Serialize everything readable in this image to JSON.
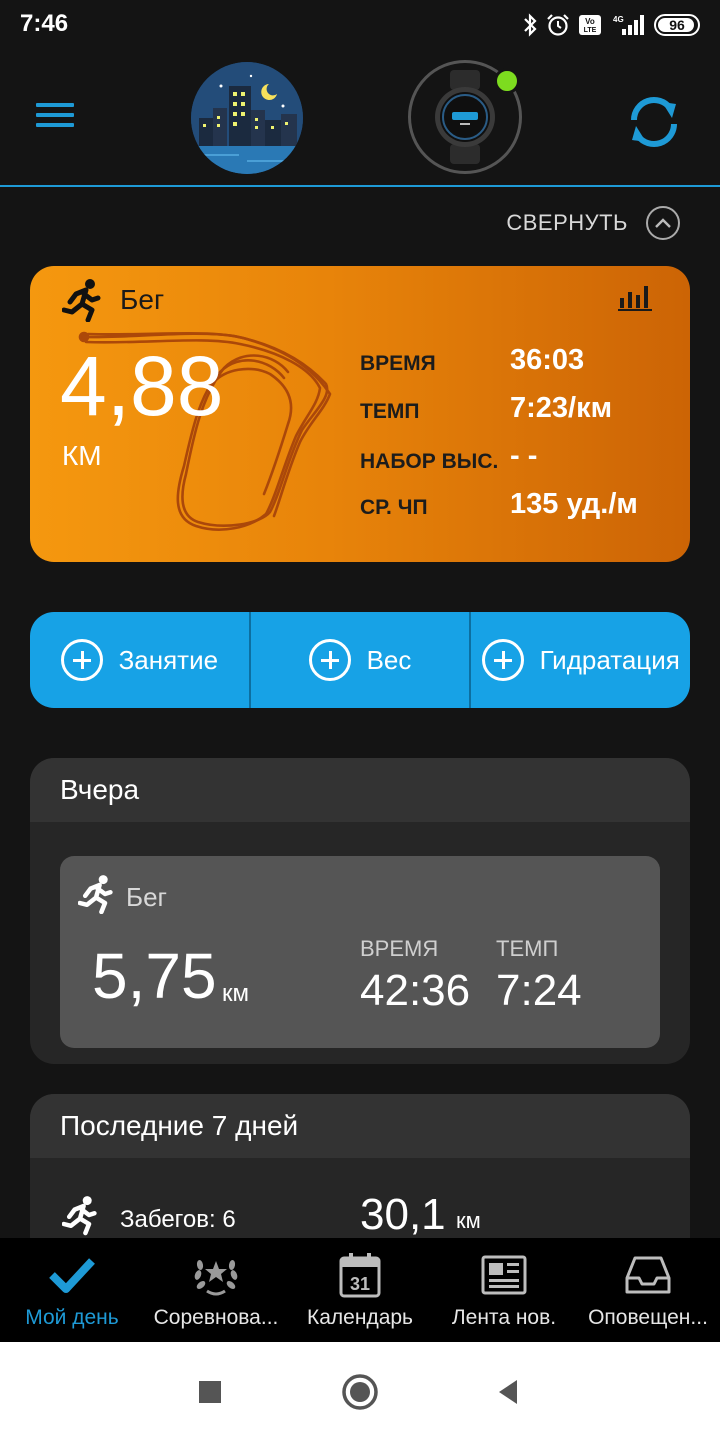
{
  "status_bar": {
    "time": "7:46",
    "battery": "96",
    "battery_level": 0.96,
    "icons": [
      "bluetooth-icon",
      "alarm-icon",
      "volte-icon",
      "signal-4g-icon",
      "battery-icon"
    ]
  },
  "header": {
    "menu_icon": "hamburger-menu-icon",
    "avatar": "city-night-avatar",
    "device": "smartwatch",
    "device_status_color": "#7ddc1f",
    "sync_icon": "sync-icon",
    "accent_color": "#1e9ad6"
  },
  "collapse": {
    "label": "СВЕРНУТЬ"
  },
  "last_activity": {
    "type": "Бег",
    "distance": "4,88",
    "unit": "КМ",
    "stats": [
      {
        "label": "ВРЕМЯ",
        "value": "36:03"
      },
      {
        "label": "ТЕМП",
        "value": "7:23/км"
      },
      {
        "label": "НАБОР ВЫС.",
        "value": "- -"
      },
      {
        "label": "СР. ЧП",
        "value": "135 уд./м"
      }
    ]
  },
  "quick_add": [
    {
      "label": "Занятие"
    },
    {
      "label": "Вес"
    },
    {
      "label": "Гидратация"
    }
  ],
  "yesterday": {
    "title": "Вчера",
    "activity": "Бег",
    "distance": "5,75",
    "unit": "км",
    "time_label": "ВРЕМЯ",
    "time_value": "42:36",
    "pace_label": "ТЕМП",
    "pace_value": "7:24"
  },
  "last_7_days": {
    "title": "Последние 7 дней",
    "runs": "Забегов: 6",
    "distance": "30,1",
    "unit": "км"
  },
  "bottom_nav": [
    {
      "label": "Мой день",
      "icon": "checkmark-icon",
      "active": true
    },
    {
      "label": "Соревнова...",
      "icon": "laurel-icon",
      "active": false
    },
    {
      "label": "Календарь",
      "icon": "calendar-icon",
      "active": false
    },
    {
      "label": "Лента нов.",
      "icon": "newsfeed-icon",
      "active": false
    },
    {
      "label": "Оповещен...",
      "icon": "inbox-icon",
      "active": false
    }
  ],
  "calendar_day": "31"
}
